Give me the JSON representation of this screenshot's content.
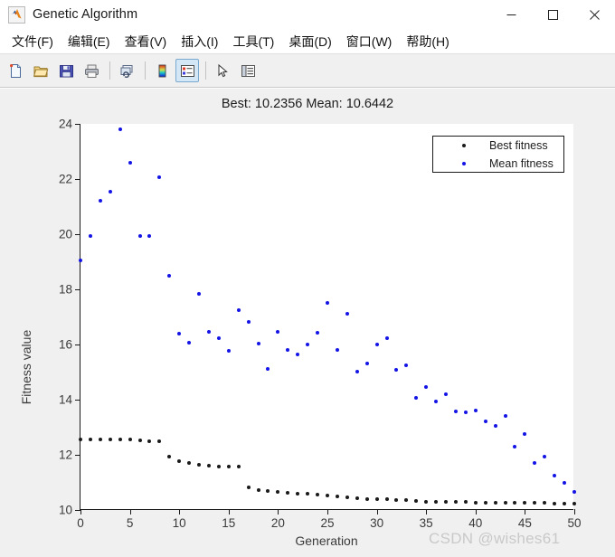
{
  "window": {
    "title": "Genetic Algorithm",
    "icon": "matlab-icon",
    "controls": {
      "minimize": "—",
      "maximize": "□",
      "close": "✕"
    }
  },
  "menubar": {
    "items": [
      {
        "label": "文件(F)",
        "name": "menu-file"
      },
      {
        "label": "编辑(E)",
        "name": "menu-edit"
      },
      {
        "label": "查看(V)",
        "name": "menu-view"
      },
      {
        "label": "插入(I)",
        "name": "menu-insert"
      },
      {
        "label": "工具(T)",
        "name": "menu-tools"
      },
      {
        "label": "桌面(D)",
        "name": "menu-desktop"
      },
      {
        "label": "窗口(W)",
        "name": "menu-window"
      },
      {
        "label": "帮助(H)",
        "name": "menu-help"
      }
    ]
  },
  "toolbar": {
    "buttons": [
      {
        "name": "new-figure-icon",
        "active": false
      },
      {
        "name": "open-file-icon",
        "active": false
      },
      {
        "name": "save-figure-icon",
        "active": false
      },
      {
        "name": "print-figure-icon",
        "active": false
      },
      {
        "name": "link-plot-icon",
        "active": false
      },
      {
        "name": "insert-colorbar-icon",
        "active": false
      },
      {
        "name": "insert-legend-icon",
        "active": true
      },
      {
        "name": "edit-pointer-icon",
        "active": false
      },
      {
        "name": "show-property-editor-icon",
        "active": false
      }
    ]
  },
  "watermark": "CSDN @wishes61",
  "chart_data": {
    "type": "scatter",
    "title": "Best: 10.2356 Mean: 10.6442",
    "xlabel": "Generation",
    "ylabel": "Fitness value",
    "xlim": [
      0,
      50
    ],
    "ylim": [
      10,
      24
    ],
    "xticks": [
      0,
      5,
      10,
      15,
      20,
      25,
      30,
      35,
      40,
      45,
      50
    ],
    "yticks": [
      10,
      12,
      14,
      16,
      18,
      20,
      22,
      24
    ],
    "grid": false,
    "legend_position": "top-right",
    "best_value": 10.2356,
    "mean_value": 10.6442,
    "x": [
      0,
      1,
      2,
      3,
      4,
      5,
      6,
      7,
      8,
      9,
      10,
      11,
      12,
      13,
      14,
      15,
      16,
      17,
      18,
      19,
      20,
      21,
      22,
      23,
      24,
      25,
      26,
      27,
      28,
      29,
      30,
      31,
      32,
      33,
      34,
      35,
      36,
      37,
      38,
      39,
      40,
      41,
      42,
      43,
      44,
      45,
      46,
      47,
      48,
      49,
      50
    ],
    "series": [
      {
        "name": "Best fitness",
        "color": "#1a1a1a",
        "values": [
          12.55,
          12.55,
          12.55,
          12.55,
          12.55,
          12.55,
          12.52,
          12.5,
          12.5,
          11.93,
          11.78,
          11.7,
          11.63,
          11.6,
          11.58,
          11.57,
          11.57,
          10.82,
          10.72,
          10.68,
          10.66,
          10.63,
          10.6,
          10.58,
          10.56,
          10.54,
          10.5,
          10.45,
          10.42,
          10.4,
          10.39,
          10.38,
          10.37,
          10.36,
          10.33,
          10.31,
          10.3,
          10.29,
          10.28,
          10.28,
          10.27,
          10.27,
          10.26,
          10.26,
          10.26,
          10.25,
          10.25,
          10.25,
          10.24,
          10.24,
          10.2356
        ]
      },
      {
        "name": "Mean fitness",
        "color": "#1414e6",
        "values": [
          19.05,
          19.92,
          21.2,
          21.53,
          23.8,
          22.58,
          19.93,
          19.94,
          22.08,
          18.5,
          16.38,
          16.05,
          17.85,
          16.45,
          16.22,
          15.78,
          17.23,
          16.82,
          16.03,
          15.12,
          16.45,
          15.8,
          15.63,
          16.0,
          16.42,
          17.52,
          15.8,
          17.12,
          15.02,
          15.32,
          16.0,
          16.22,
          15.08,
          15.25,
          14.05,
          14.45,
          13.92,
          14.2,
          13.58,
          13.55,
          13.62,
          13.2,
          13.05,
          13.42,
          12.3,
          12.75,
          11.7,
          11.95,
          11.25,
          10.98,
          10.6442
        ]
      }
    ]
  }
}
